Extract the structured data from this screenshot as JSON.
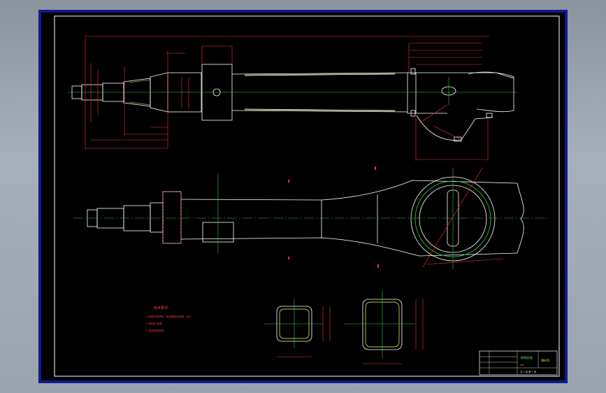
{
  "colors": {
    "background_window": "#9aa3ad",
    "frame_outer": "#0f1a8a",
    "sheet": "#000000",
    "geometry": "#ffffff",
    "dimension": "#ff3030",
    "centerline": "#2ecc40",
    "accent_green": "#5aff7a",
    "hatch": "#ffff66"
  },
  "notes": {
    "title": "技术要求",
    "lines": [
      "1. 焊接前清除焊缝，保证焊接处无锈蚀、油污。",
      "2. 焊后退火处理。",
      "3. 焊后做探伤检查。"
    ]
  },
  "title_block": {
    "name_label": "桥壳总成",
    "drawing_no": "QK-01",
    "scale": "1:5",
    "sheet_info": "共 1 张  第 1 张"
  },
  "icons": {
    "title_block": "title-block-icon",
    "section": "section-view-icon"
  }
}
